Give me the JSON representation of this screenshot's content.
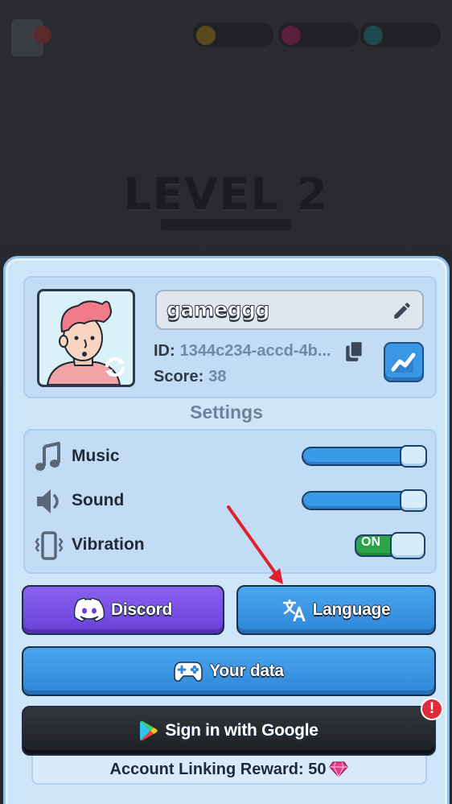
{
  "background": {
    "level_text": "LEVEL 2"
  },
  "profile": {
    "username": "gameggg",
    "id_label": "ID:",
    "id_value": "1344c234-accd-4b...",
    "score_label": "Score:",
    "score_value": "38"
  },
  "settings": {
    "title": "Settings",
    "items": [
      {
        "label": "Music",
        "icon": "music-note-icon",
        "level": 1.0
      },
      {
        "label": "Sound",
        "icon": "speaker-icon",
        "level": 1.0
      },
      {
        "label": "Vibration",
        "icon": "vibration-icon",
        "state": "ON"
      }
    ]
  },
  "buttons": {
    "discord": "Discord",
    "language": "Language",
    "your_data": "Your data",
    "google": "Sign in with Google"
  },
  "reward": {
    "text": "Account Linking Reward: 50",
    "icon": "gem-icon"
  },
  "alert_badge": "!",
  "colors": {
    "panel": "#cfe6fa",
    "primary_button": "#3a97e6",
    "discord": "#7b52e6",
    "toggle_on": "#2aa54a",
    "alert": "#e22b3a",
    "annotation_arrow": "#e0202a"
  }
}
